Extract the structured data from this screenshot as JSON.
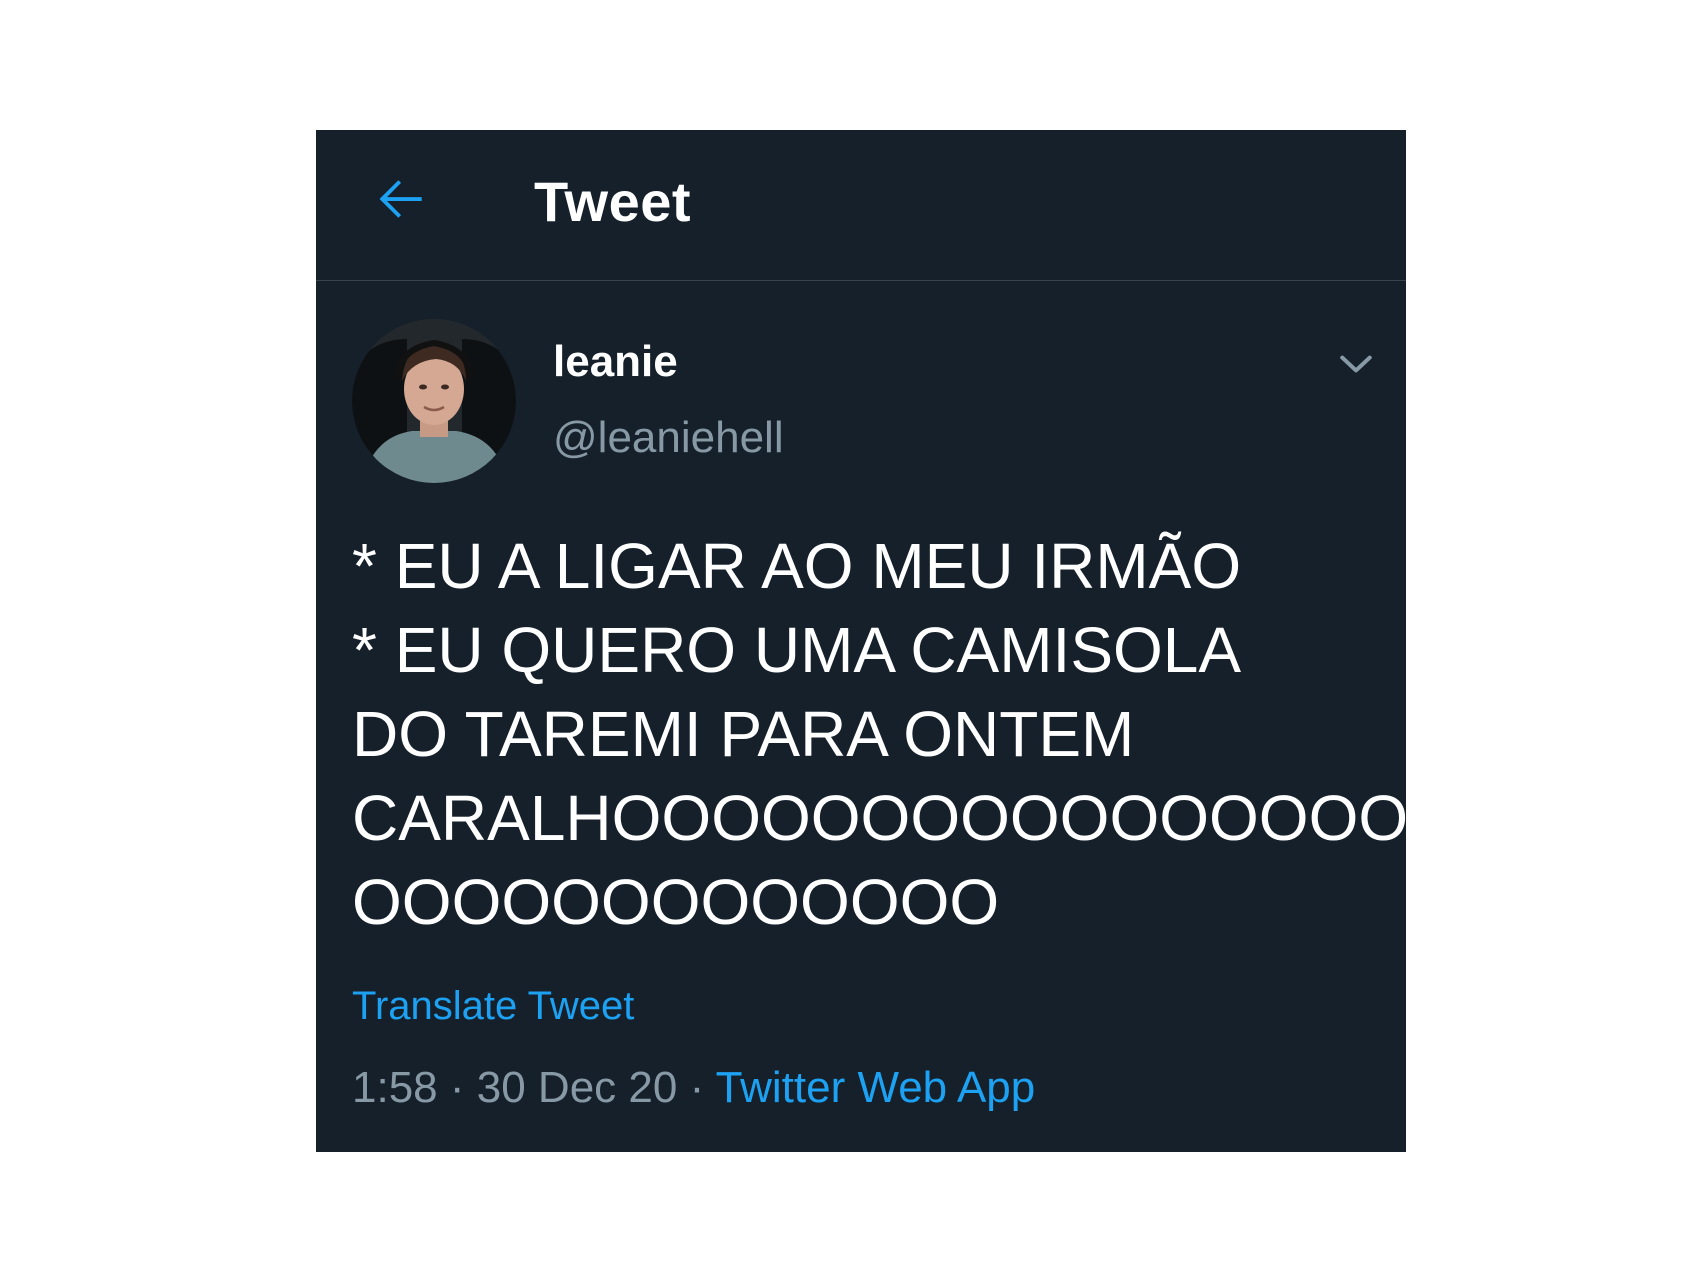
{
  "header": {
    "back_icon": "arrow-left-icon",
    "title": "Tweet"
  },
  "tweet": {
    "author": {
      "display_name": "leanie",
      "username": "@leaniehell"
    },
    "menu_icon": "chevron-down-icon",
    "text_lines": [
      "* EU A LIGAR AO MEU IRMÃO",
      "* EU QUERO UMA CAMISOLA",
      "DO TAREMI PARA ONTEM",
      "CARALHOOOOOOOOOOOOOOOOO",
      "OOOOOOOOOOOOO"
    ],
    "translate_label": "Translate Tweet",
    "time": "1:58",
    "separator": "·",
    "date": "30 Dec 20",
    "source": "Twitter Web App"
  },
  "colors": {
    "background": "#15202b",
    "accent": "#1da1f2",
    "secondary_text": "#8899a6",
    "divider": "#38444d"
  }
}
